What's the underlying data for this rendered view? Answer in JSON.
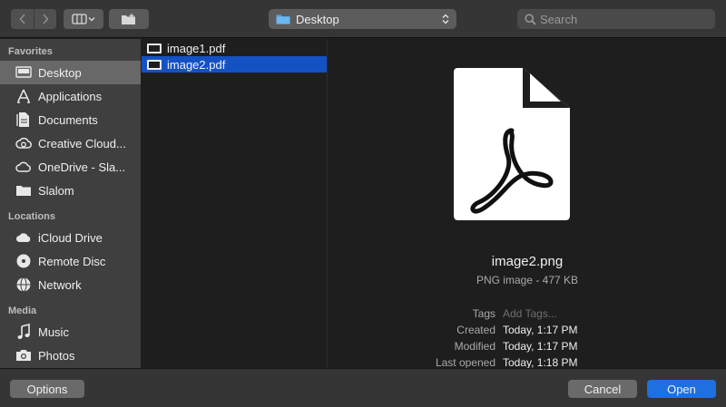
{
  "toolbar": {
    "location": "Desktop",
    "search_placeholder": "Search"
  },
  "sidebar": {
    "sections": [
      {
        "title": "Favorites",
        "items": [
          {
            "label": "Desktop",
            "icon": "desktop-icon",
            "selected": true
          },
          {
            "label": "Applications",
            "icon": "applications-icon"
          },
          {
            "label": "Documents",
            "icon": "documents-icon"
          },
          {
            "label": "Creative Cloud...",
            "icon": "creative-cloud-icon"
          },
          {
            "label": "OneDrive - Sla...",
            "icon": "cloud-icon"
          },
          {
            "label": "Slalom",
            "icon": "folder-icon"
          }
        ]
      },
      {
        "title": "Locations",
        "items": [
          {
            "label": "iCloud Drive",
            "icon": "icloud-icon"
          },
          {
            "label": "Remote Disc",
            "icon": "disc-icon"
          },
          {
            "label": "Network",
            "icon": "network-icon"
          }
        ]
      },
      {
        "title": "Media",
        "items": [
          {
            "label": "Music",
            "icon": "music-icon"
          },
          {
            "label": "Photos",
            "icon": "camera-icon"
          }
        ]
      }
    ]
  },
  "files": [
    {
      "name": "image1.pdf",
      "selected": false
    },
    {
      "name": "image2.pdf",
      "selected": true
    }
  ],
  "preview": {
    "filename": "image2.png",
    "kind": "PNG image - 477 KB",
    "meta": [
      {
        "key": "Tags",
        "value": "Add Tags...",
        "placeholder": true
      },
      {
        "key": "Created",
        "value": "Today, 1:17 PM"
      },
      {
        "key": "Modified",
        "value": "Today, 1:17 PM"
      },
      {
        "key": "Last opened",
        "value": "Today, 1:18 PM"
      }
    ]
  },
  "buttons": {
    "options": "Options",
    "cancel": "Cancel",
    "open": "Open"
  },
  "colors": {
    "accent": "#1e6fe0",
    "selection": "#1452c4",
    "sidebar": "#3f3f3f"
  }
}
